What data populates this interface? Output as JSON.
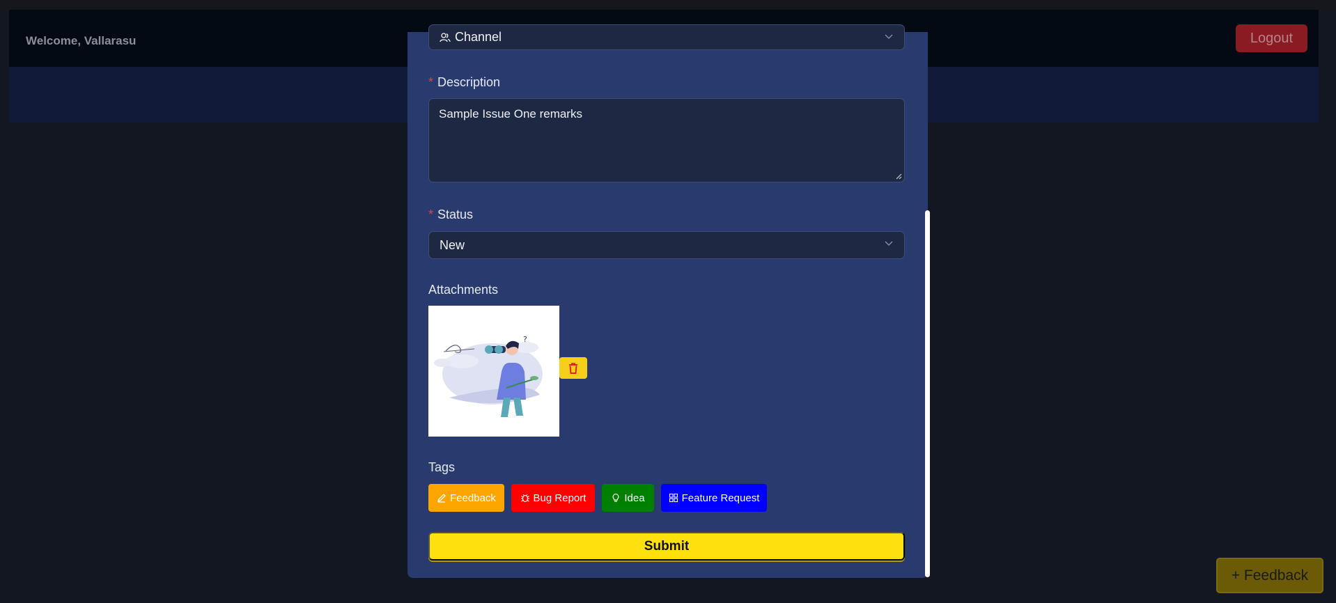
{
  "header": {
    "welcome_text": "Welcome, Vallarasu",
    "logout_label": "Logout"
  },
  "fab": {
    "feedback_label": "+ Feedback"
  },
  "form": {
    "channel": {
      "value": "Channel",
      "icon": "users-icon"
    },
    "description": {
      "label": "Description",
      "required_mark": "*",
      "value": "Sample Issue One remarks"
    },
    "status": {
      "label": "Status",
      "required_mark": "*",
      "value": "New"
    },
    "attachments": {
      "label": "Attachments",
      "image_alt": "person with binoculars illustration"
    },
    "tags": {
      "label": "Tags",
      "items": [
        {
          "label": "Feedback",
          "icon": "pencil-icon",
          "color": "#ffa500"
        },
        {
          "label": "Bug Report",
          "icon": "bug-icon",
          "color": "#ff0000"
        },
        {
          "label": "Idea",
          "icon": "lightbulb-icon",
          "color": "#008000"
        },
        {
          "label": "Feature Request",
          "icon": "grid-icon",
          "color": "#0000ff"
        }
      ]
    },
    "submit_label": "Submit"
  },
  "colors": {
    "modal_bg": "#283a6e",
    "submit_bg": "#ffe00f",
    "logout_bg": "#8b1b22",
    "trash_bg": "#f5cf1a"
  }
}
